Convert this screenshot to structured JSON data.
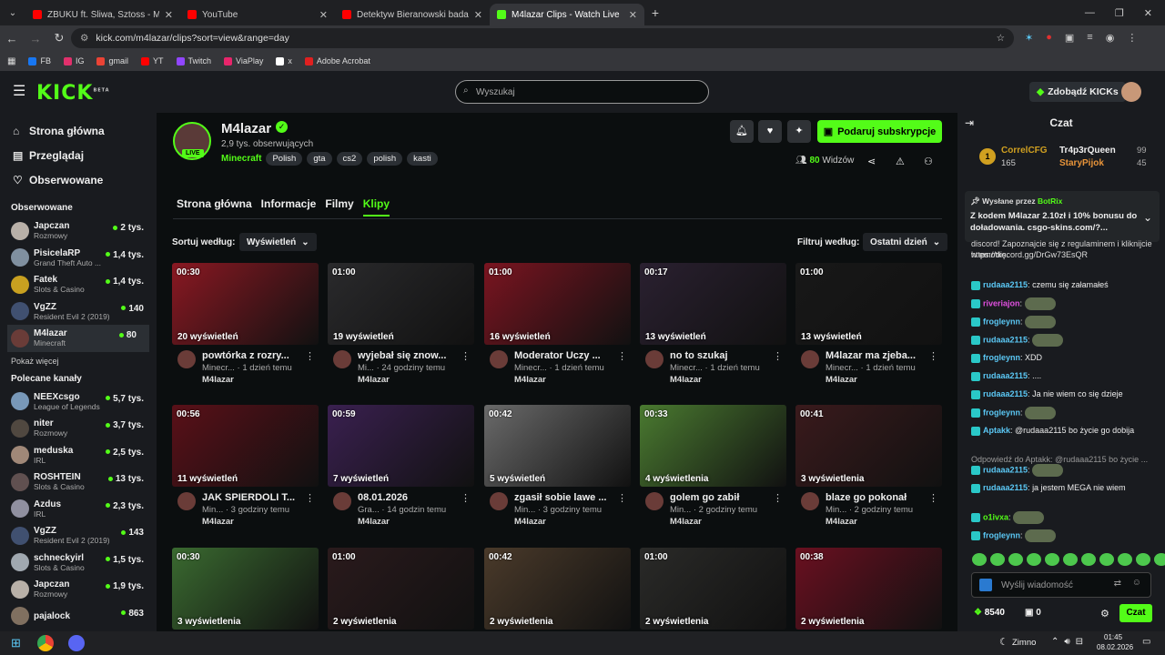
{
  "browser": {
    "tabs": [
      {
        "title": "ZBUKU ft. Śliwa, Sztoss - Młoda",
        "color": "#ff0000",
        "active": false
      },
      {
        "title": "YouTube",
        "color": "#ff0000",
        "active": false
      },
      {
        "title": "Detektyw Bieranowski bada spr",
        "color": "#ff0000",
        "active": false
      },
      {
        "title": "M4lazar Clips - Watch Live",
        "color": "#53fc18",
        "active": true
      }
    ],
    "url": "kick.com/m4lazar/clips?sort=view&range=day",
    "bookmarks": [
      {
        "label": "FB",
        "color": "#1877f2"
      },
      {
        "label": "IG",
        "color": "#e1306c"
      },
      {
        "label": "gmail",
        "color": "#ea4335"
      },
      {
        "label": "YT",
        "color": "#ff0000"
      },
      {
        "label": "Twitch",
        "color": "#9146ff"
      },
      {
        "label": "ViaPlay",
        "color": "#e8256b"
      },
      {
        "label": "x",
        "color": "#ffffff"
      },
      {
        "label": "Adobe Acrobat",
        "color": "#e02020"
      }
    ]
  },
  "header": {
    "logo": "KICK",
    "logo_badge": "BETA",
    "search_placeholder": "Wyszukaj",
    "kicks_button": "Zdobądź KICKs"
  },
  "sidebar": {
    "nav": [
      {
        "label": "Strona główna",
        "icon": "home-icon"
      },
      {
        "label": "Przeglądaj",
        "icon": "browse-icon"
      },
      {
        "label": "Obserwowane",
        "icon": "heart-icon"
      }
    ],
    "followed_title": "Obserwowane",
    "followed": [
      {
        "name": "Japczan",
        "game": "Rozmowy",
        "viewers": "2 tys.",
        "color": "#b8b0a8"
      },
      {
        "name": "PisicelaRP",
        "game": "Grand Theft Auto ...",
        "viewers": "1,4 tys.",
        "color": "#8090a0"
      },
      {
        "name": "Fatek",
        "game": "Slots & Casino",
        "viewers": "1,4 tys.",
        "color": "#c8a020"
      },
      {
        "name": "VgZZ",
        "game": "Resident Evil 2 (2019)",
        "viewers": "140",
        "color": "#405070"
      },
      {
        "name": "M4lazar",
        "game": "Minecraft",
        "viewers": "80",
        "color": "#6a3c38"
      }
    ],
    "show_more": "Pokaż więcej",
    "recommended_title": "Polecane kanały",
    "recommended": [
      {
        "name": "NEEXcsgo",
        "game": "League of Legends",
        "viewers": "5,7 tys.",
        "color": "#7898b8"
      },
      {
        "name": "niter",
        "game": "Rozmowy",
        "viewers": "3,7 tys.",
        "color": "#504840"
      },
      {
        "name": "meduska",
        "game": "IRL",
        "viewers": "2,5 tys.",
        "color": "#a08878"
      },
      {
        "name": "ROSHTEIN",
        "game": "Slots & Casino",
        "viewers": "13 tys.",
        "color": "#605050"
      },
      {
        "name": "Azdus",
        "game": "IRL",
        "viewers": "2,3 tys.",
        "color": "#9090a0"
      },
      {
        "name": "VgZZ",
        "game": "Resident Evil 2 (2019)",
        "viewers": "143",
        "color": "#405070"
      },
      {
        "name": "schneckyirl",
        "game": "Slots & Casino",
        "viewers": "1,5 tys.",
        "color": "#a0a8b0"
      },
      {
        "name": "Japczan",
        "game": "Rozmowy",
        "viewers": "1,9 tys.",
        "color": "#b8b0a8"
      },
      {
        "name": "pajalock",
        "game": "",
        "viewers": "863",
        "color": "#807060"
      }
    ]
  },
  "channel": {
    "name": "M4lazar",
    "live": "LIVE",
    "followers": "2,9 tys. obserwujących",
    "category": "Minecraft",
    "tags": [
      "Polish",
      "gta",
      "cs2",
      "polish",
      "kasti"
    ],
    "sub_button": "Podaruj subskrypcje",
    "viewers": "80",
    "viewers_label": "Widzów"
  },
  "tabs": [
    "Strona główna",
    "Informacje",
    "Filmy",
    "Klipy"
  ],
  "active_tab": "Klipy",
  "sort": {
    "label": "Sortuj według:",
    "value": "Wyświetleń"
  },
  "filter": {
    "label": "Filtruj według:",
    "value": "Ostatni dzień"
  },
  "clips": [
    {
      "duration": "00:30",
      "views": "20 wyświetleń",
      "title": "powtórka z rozry...",
      "meta": "Minecr... · 1 dzień temu",
      "channel": "M4lazar",
      "bg": "#8a1822"
    },
    {
      "duration": "01:00",
      "views": "19 wyświetleń",
      "title": "wyjebał się znow...",
      "meta": "Mi... · 24 godziny temu",
      "channel": "M4lazar",
      "bg": "#2a2a2c"
    },
    {
      "duration": "01:00",
      "views": "16 wyświetleń",
      "title": "Moderator Uczy ...",
      "meta": "Minecr... · 1 dzień temu",
      "channel": "M4lazar",
      "bg": "#7a1420"
    },
    {
      "duration": "00:17",
      "views": "13 wyświetleń",
      "title": "no to szukaj",
      "meta": "Minecr... · 1 dzień temu",
      "channel": "M4lazar",
      "bg": "#2a2030"
    },
    {
      "duration": "01:00",
      "views": "13 wyświetleń",
      "title": "M4lazar ma zjeba...",
      "meta": "Minecr... · 1 dzień temu",
      "channel": "M4lazar",
      "bg": "#181818"
    },
    {
      "duration": "00:56",
      "views": "11 wyświetleń",
      "title": "JAK SPIERDOLI T...",
      "meta": "Min... · 3 godziny temu",
      "channel": "M4lazar",
      "bg": "#5a1018"
    },
    {
      "duration": "00:59",
      "views": "7 wyświetleń",
      "title": "08.01.2026",
      "meta": "Gra... · 14 godzin temu",
      "channel": "M4lazar",
      "bg": "#3a2050"
    },
    {
      "duration": "00:42",
      "views": "5 wyświetleń",
      "title": "zgasił sobie lawe ...",
      "meta": "Min... · 3 godziny temu",
      "channel": "M4lazar",
      "bg": "#6a6a6a"
    },
    {
      "duration": "00:33",
      "views": "4 wyświetlenia",
      "title": "golem go zabił",
      "meta": "Min... · 2 godziny temu",
      "channel": "M4lazar",
      "bg": "#4a7a30"
    },
    {
      "duration": "00:41",
      "views": "3 wyświetlenia",
      "title": "blaze go pokonał",
      "meta": "Min... · 2 godziny temu",
      "channel": "M4lazar",
      "bg": "#3a1a1c"
    },
    {
      "duration": "00:30",
      "views": "3 wyświetlenia",
      "title": "",
      "meta": "",
      "channel": "",
      "bg": "#3a6a30"
    },
    {
      "duration": "01:00",
      "views": "2 wyświetlenia",
      "title": "",
      "meta": "",
      "channel": "",
      "bg": "#2a1a1c"
    },
    {
      "duration": "00:42",
      "views": "2 wyświetlenia",
      "title": "",
      "meta": "",
      "channel": "",
      "bg": "#4a3a2a"
    },
    {
      "duration": "01:00",
      "views": "2 wyświetlenia",
      "title": "",
      "meta": "",
      "channel": "",
      "bg": "#2a2a28"
    },
    {
      "duration": "00:38",
      "views": "2 wyświetlenia",
      "title": "",
      "meta": "",
      "channel": "",
      "bg": "#6a1020"
    }
  ],
  "chat": {
    "title": "Czat",
    "leaders": [
      {
        "name": "CorrelCFG",
        "value": "165"
      },
      {
        "name": "Tr4p3rQueen",
        "value": "99"
      },
      {
        "name": "StaryPijok",
        "value": "45"
      }
    ],
    "pinned_by": "Wysłane przez",
    "pinned_user": "BotRix",
    "pinned_text": "Z kodem M4lazar 2.10zł i 10% bonusu do doładowania. csgo-skins.com/?...",
    "messages": [
      {
        "user": "",
        "text": "discord! Zapoznajcie się z regulaminem i kliknijcie w emotkę.",
        "color": "#ddd"
      },
      {
        "user": "",
        "text": "https://discord.gg/DrGw73EsQR",
        "color": "#ddd"
      },
      {
        "user": "rudaaa2115",
        "text": "czemu się załamałeś",
        "color": "#5bc8f5"
      },
      {
        "user": "riveriajon",
        "text": "",
        "color": "#e050e0"
      },
      {
        "user": "frogleynn",
        "text": "",
        "color": "#5bc8f5"
      },
      {
        "user": "rudaaa2115",
        "text": "",
        "color": "#5bc8f5"
      },
      {
        "user": "frogleynn",
        "text": "XDD",
        "color": "#5bc8f5"
      },
      {
        "user": "rudaaa2115",
        "text": "....",
        "color": "#5bc8f5"
      },
      {
        "user": "rudaaa2115",
        "text": "Ja nie wiem co się dzieje",
        "color": "#5bc8f5"
      },
      {
        "user": "frogleynn",
        "text": "",
        "color": "#5bc8f5"
      },
      {
        "user": "Aptakk",
        "text": "@rudaaa2115 bo życie go dobija",
        "color": "#5bc8f5"
      },
      {
        "user": "",
        "text": "Odpowiedź do Aptakk: @rudaaa2115 bo życie ...",
        "color": "#999"
      },
      {
        "user": "rudaaa2115",
        "text": "",
        "color": "#5bc8f5"
      },
      {
        "user": "rudaaa2115",
        "text": "ja jestem MEGA nie wiem",
        "color": "#5bc8f5"
      },
      {
        "user": "o1ivxa",
        "text": "",
        "color": "#53fc18"
      },
      {
        "user": "frogleynn",
        "text": "",
        "color": "#5bc8f5"
      }
    ],
    "input_placeholder": "Wyślij wiadomość",
    "points": "8540",
    "items": "0",
    "send": "Czat"
  },
  "taskbar": {
    "weather": "Zimno",
    "time": "01:45",
    "date": "08.02.2026"
  }
}
